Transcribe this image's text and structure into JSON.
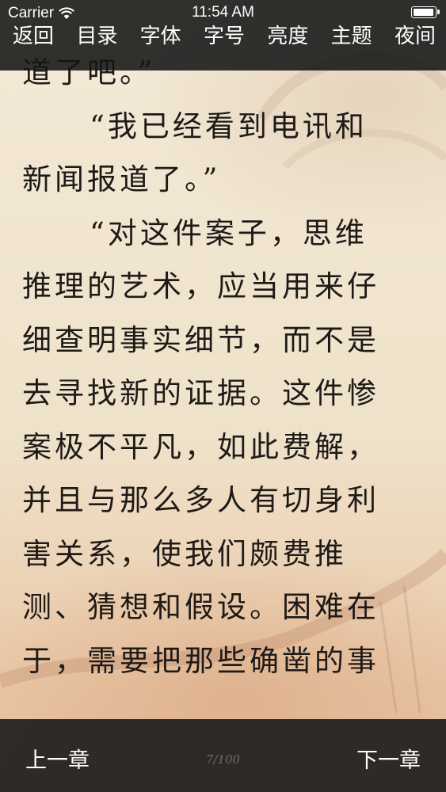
{
  "status_bar": {
    "carrier": "Carrier",
    "time": "11:54 AM",
    "battery_level": 1.0
  },
  "top_menu": {
    "back": "返回",
    "contents": "目录",
    "font": "字体",
    "font_size": "字号",
    "brightness": "亮度",
    "theme": "主题",
    "night": "夜间"
  },
  "content": {
    "lines": [
      "道了吧。”",
      "“我已经看到电讯和",
      "新闻报道了。”",
      "“对这件案子，思维",
      "推理的艺术，应当用来仔",
      "细查明事实细节，而不是",
      "去寻找新的证据。这件惨",
      "案极不平凡，如此费解，",
      "并且与那么多人有切身利",
      "害关系，使我们颇费推",
      "测、猜想和假设。困难在",
      "于，需要把那些确凿的事"
    ]
  },
  "bottom_bar": {
    "prev_chapter": "上一章",
    "next_chapter": "下一章",
    "page_indicator": "7/100"
  },
  "colors": {
    "bar_background": "#161616",
    "bar_text": "#ffffff",
    "body_text": "#1e1a17",
    "paper": "#efe2ca"
  }
}
